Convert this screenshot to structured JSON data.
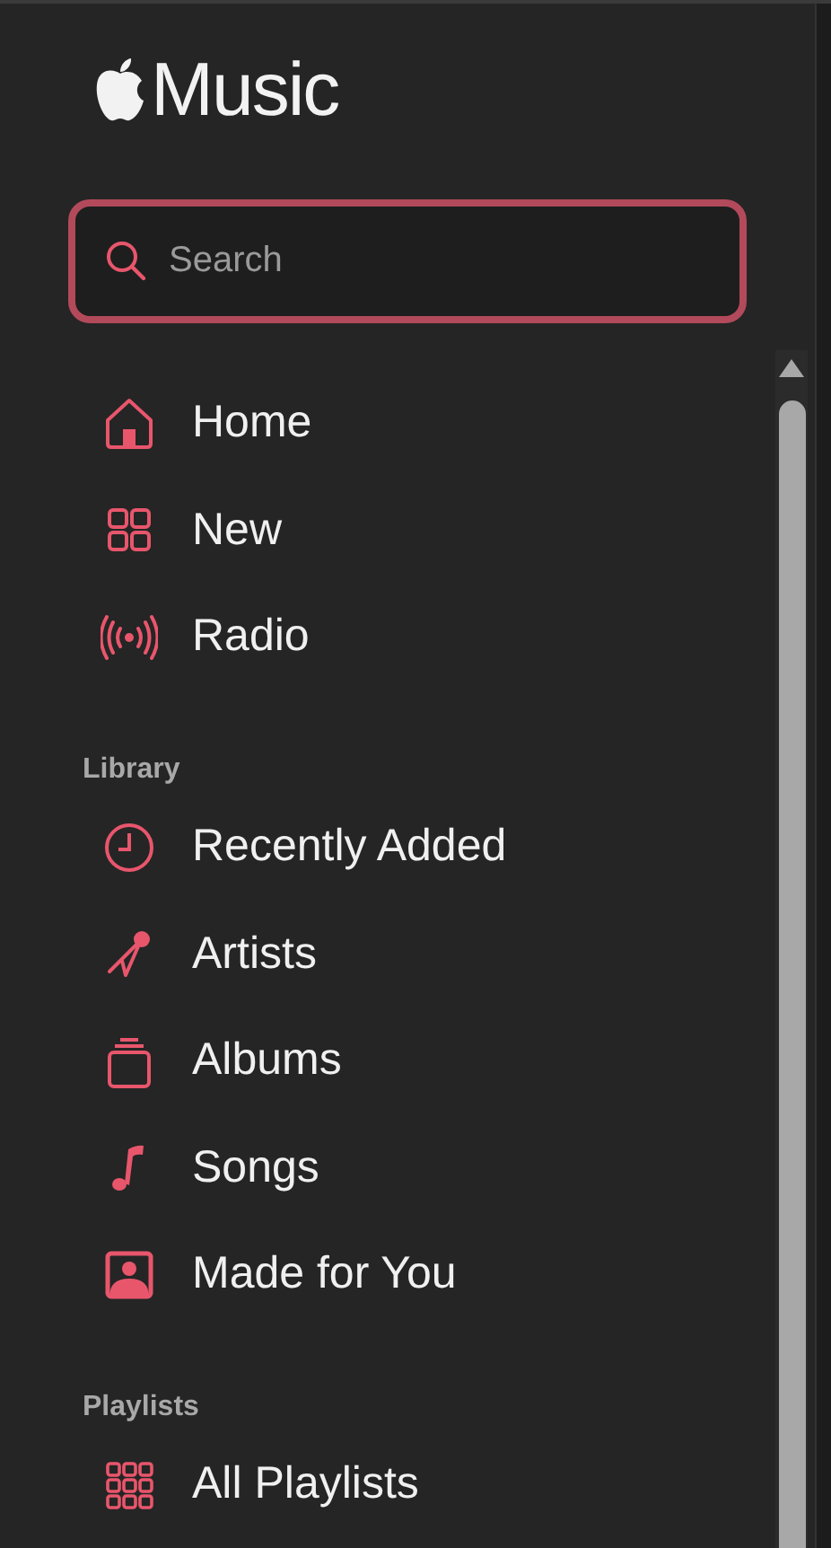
{
  "logo": {
    "text": "Music"
  },
  "search": {
    "placeholder": "Search"
  },
  "sections": [
    {
      "items": [
        {
          "label": "Home"
        },
        {
          "label": "New"
        },
        {
          "label": "Radio"
        }
      ]
    },
    {
      "title": "Library",
      "items": [
        {
          "label": "Recently Added"
        },
        {
          "label": "Artists"
        },
        {
          "label": "Albums"
        },
        {
          "label": "Songs"
        },
        {
          "label": "Made for You"
        }
      ]
    },
    {
      "title": "Playlists",
      "items": [
        {
          "label": "All Playlists"
        }
      ]
    }
  ]
}
